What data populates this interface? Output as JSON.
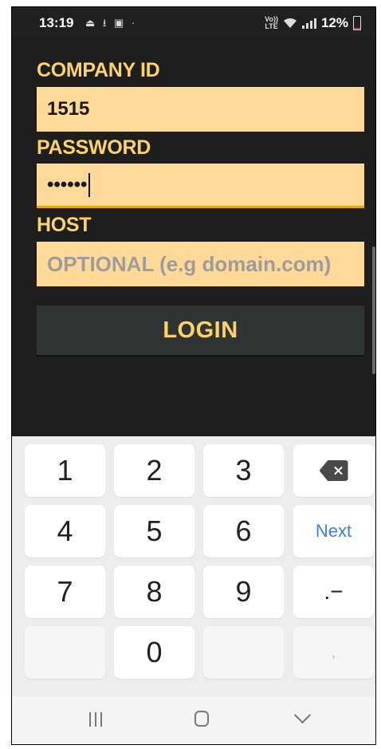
{
  "status_bar": {
    "time": "13:19",
    "left_icons": "⏏ ⭳ ▣ ·",
    "network_top": "Vo))",
    "network_bottom": "LTE",
    "battery_percent": "12%"
  },
  "form": {
    "company_label": "COMPANY ID",
    "company_value": "1515",
    "password_label": "PASSWORD",
    "password_value": "••••••",
    "host_label": "HOST",
    "host_placeholder": "OPTIONAL (e.g domain.com)",
    "login_label": "LOGIN"
  },
  "keyboard": {
    "keys": {
      "k1": "1",
      "k2": "2",
      "k3": "3",
      "k4": "4",
      "k5": "5",
      "k6": "6",
      "next": "Next",
      "k7": "7",
      "k8": "8",
      "k9": "9",
      "punct": ".−",
      "k0": "0",
      "comma": ","
    }
  },
  "colors": {
    "accent": "#ffd267",
    "field_bg": "#ffd998",
    "button_bg": "#2f3535",
    "next_key": "#3b82d6"
  }
}
